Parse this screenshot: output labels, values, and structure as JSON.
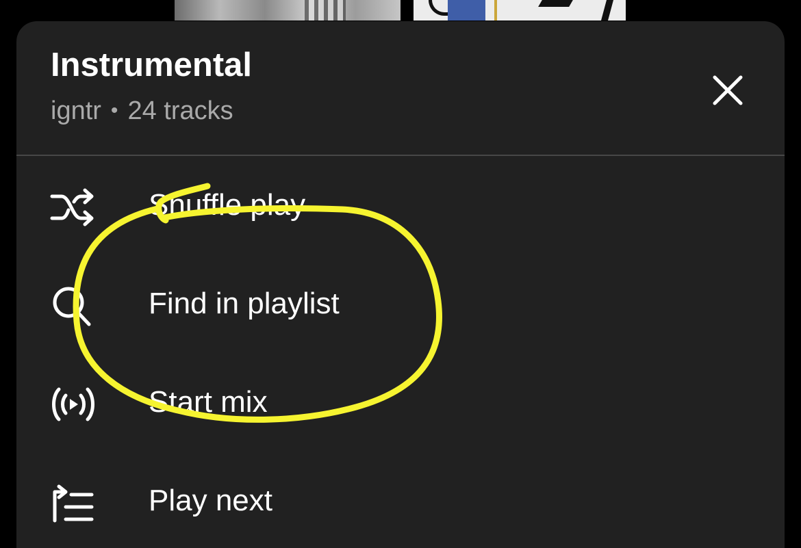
{
  "playlist": {
    "title": "Instrumental",
    "owner": "igntr",
    "separator": "•",
    "track_count": "24 tracks"
  },
  "menu": {
    "items": [
      {
        "label": "Shuffle play",
        "icon": "shuffle-icon"
      },
      {
        "label": "Find in playlist",
        "icon": "search-icon"
      },
      {
        "label": "Start mix",
        "icon": "radio-mix-icon"
      },
      {
        "label": "Play next",
        "icon": "play-next-icon"
      }
    ]
  },
  "colors": {
    "background": "#000000",
    "sheet": "#212121",
    "divider": "#474747",
    "primary_text": "#ffffff",
    "secondary_text": "#aaaaaa",
    "annotation": "#f6f430"
  }
}
